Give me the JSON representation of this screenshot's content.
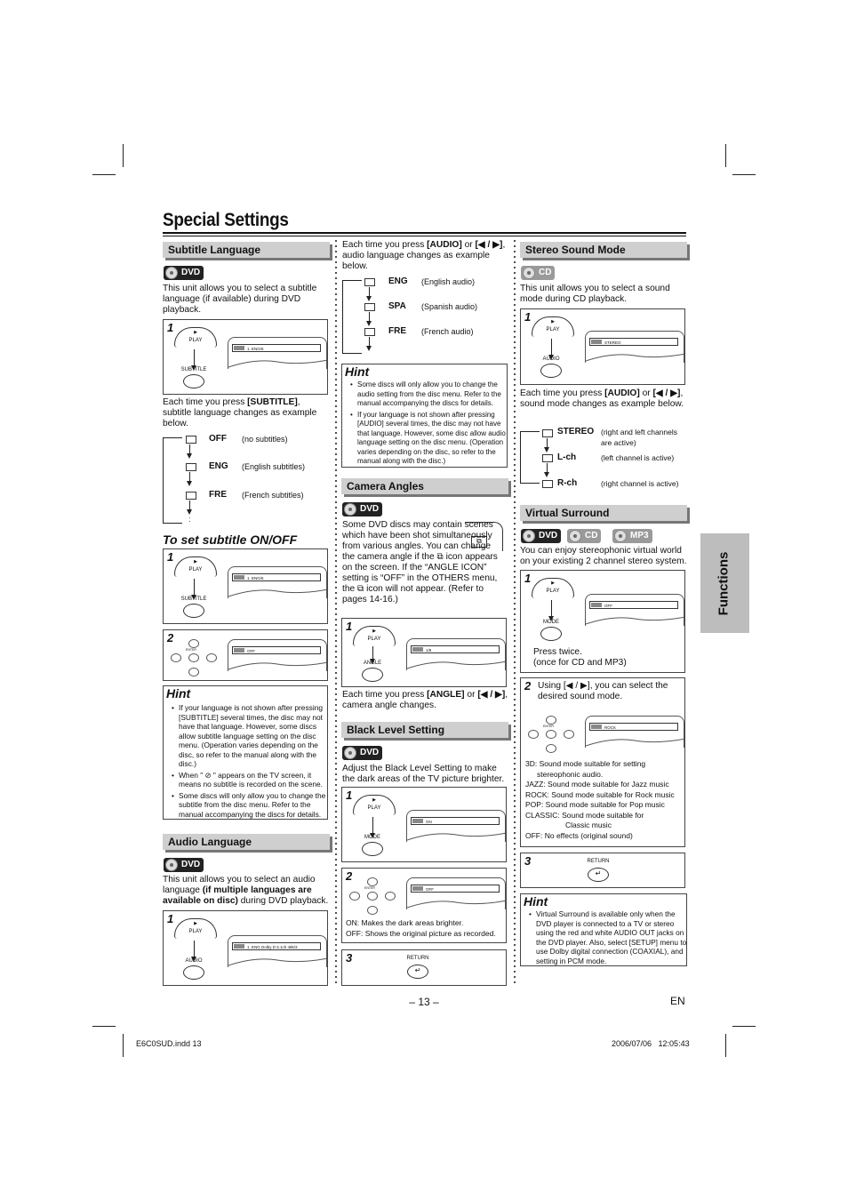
{
  "page": {
    "title": "Special Settings",
    "page_number": "– 13 –",
    "language": "EN",
    "side_tab": "Functions",
    "footer_left": "E6C0SUD.indd   13",
    "footer_right": "2006/07/06   12:05:43"
  },
  "subtitle_language": {
    "heading": "Subtitle Language",
    "badge": "DVD",
    "intro": "This unit allows you to select a subtitle language (if available) during DVD playback.",
    "step1": {
      "num": "1",
      "btn1": "PLAY",
      "btn2": "SUBTITLE",
      "screen": "1. ENG/6"
    },
    "each_time_pre": "Each time you press ",
    "each_time_key": "[SUBTITLE]",
    "each_time_post": ", subtitle language changes as example below.",
    "sequence": [
      {
        "code": "OFF",
        "desc": "(no subtitles)"
      },
      {
        "code": "ENG",
        "desc": "(English subtitles)"
      },
      {
        "code": "FRE",
        "desc": "(French subtitles)"
      }
    ],
    "onoff_heading": "To set subtitle ON/OFF",
    "onoff_step1": {
      "num": "1",
      "btn1": "PLAY",
      "btn2": "SUBTITLE",
      "screen": "1. ENG/6"
    },
    "onoff_step2": {
      "num": "2",
      "enter": "ENTER",
      "screen": "OFF"
    },
    "hint_title": "Hint",
    "hints": [
      "If your language is not shown after pressing [SUBTITLE] several times, the disc may not have that language. However, some discs allow subtitle language setting on the disc menu. (Operation varies depending on the disc, so refer to the manual along with the disc.)",
      "When \" ⊘ \" appears on the TV screen, it means no subtitle is recorded on the scene.",
      "Some discs will only allow you to change the subtitle from the disc menu. Refer to the manual accompanying the discs for details."
    ]
  },
  "audio_language": {
    "heading": "Audio Language",
    "badge": "DVD",
    "intro_pre": "This unit allows you to select an audio language ",
    "intro_bold": "(if multiple languages are available on disc)",
    "intro_post": " during DVD playback.",
    "step1": {
      "num": "1",
      "btn1": "PLAY",
      "btn2": "AUDIO",
      "screen": "1. ENG Dolby D 5.1ch 48k/3"
    },
    "each_time_pre": "Each time you press ",
    "each_time_key": "[AUDIO]",
    "each_time_mid": " or ",
    "each_time_key2": "[◀ / ▶]",
    "each_time_post": ", audio language changes as example below.",
    "sequence": [
      {
        "code": "ENG",
        "desc": "(English audio)"
      },
      {
        "code": "SPA",
        "desc": "(Spanish audio)"
      },
      {
        "code": "FRE",
        "desc": "(French audio)"
      }
    ],
    "hint_title": "Hint",
    "hints": [
      "Some discs will only allow you to change the audio setting from the disc menu. Refer to the manual accompanying the discs for details.",
      "If your language is not shown after pressing [AUDIO] several times, the disc may not have that language. However, some disc allow audio language setting on the disc menu. (Operation varies depending on the disc, so refer to the manual along with the disc.)"
    ]
  },
  "camera_angles": {
    "heading": "Camera Angles",
    "badge": "DVD",
    "intro": "Some DVD discs may contain scenes which have been shot simultaneously from various angles. You can change the camera angle if the ⧉ icon appears on the screen. If the “ANGLE ICON” setting is “OFF” in the OTHERS menu, the ⧉ icon will not appear. (Refer to pages 14-16.)",
    "step1": {
      "num": "1",
      "btn1": "PLAY",
      "btn2": "ANGLE",
      "screen": "1/8"
    },
    "each_time_pre": "Each time you press ",
    "each_time_key": "[ANGLE]",
    "each_time_mid": " or ",
    "each_time_key2": "[◀ / ▶]",
    "each_time_post": ", camera angle changes."
  },
  "black_level": {
    "heading": "Black Level Setting",
    "badge": "DVD",
    "intro": "Adjust the Black Level Setting to make the dark areas of the TV picture brighter.",
    "step1": {
      "num": "1",
      "btn1": "PLAY",
      "btn2": "MODE",
      "screen": "ON"
    },
    "step2": {
      "num": "2",
      "enter": "ENTER",
      "screen": "OFF",
      "note_on": "ON: Makes the dark areas brighter.",
      "note_off": "OFF: Shows the original picture as recorded."
    },
    "step3": {
      "num": "3",
      "btn": "RETURN"
    }
  },
  "stereo_sound": {
    "heading": "Stereo Sound Mode",
    "badge": "CD",
    "intro": "This unit allows you to select a sound mode during CD playback.",
    "step1": {
      "num": "1",
      "btn1": "PLAY",
      "btn2": "AUDIO",
      "screen": "STEREO"
    },
    "each_time_pre": "Each time you press ",
    "each_time_key": "[AUDIO]",
    "each_time_mid": " or ",
    "each_time_key2": "[◀ / ▶]",
    "each_time_post": ", sound mode changes as example below.",
    "sequence": [
      {
        "code": "STEREO",
        "desc": "(right and left channels are active)"
      },
      {
        "code": "L-ch",
        "desc": "(left channel is active)"
      },
      {
        "code": "R-ch",
        "desc": "(right channel is active)"
      }
    ]
  },
  "virtual_surround": {
    "heading": "Virtual Surround",
    "badges": [
      "DVD",
      "CD",
      "MP3"
    ],
    "intro": "You can enjoy stereophonic virtual world on your existing 2 channel stereo system.",
    "step1": {
      "num": "1",
      "btn1": "PLAY",
      "btn2": "MODE",
      "screen": "OFF",
      "note1": "Press twice.",
      "note2": "(once for CD and MP3)"
    },
    "step2": {
      "num": "2",
      "text": "Using [◀ / ▶], you can select the desired sound mode.",
      "enter": "ENTER",
      "screen": "ROCK",
      "modes": [
        "3D: Sound mode suitable for setting",
        "stereophonic audio.",
        "JAZZ: Sound mode suitable for Jazz music",
        "ROCK: Sound mode suitable for Rock music",
        "POP: Sound mode suitable for Pop music",
        "CLASSIC: Sound mode suitable for",
        "Classic music",
        "OFF: No effects (original sound)"
      ]
    },
    "step3": {
      "num": "3",
      "btn": "RETURN"
    },
    "hint_title": "Hint",
    "hints": [
      "Virtual Surround is available only when the DVD player is connected to a TV or stereo using the red and white AUDIO OUT jacks on the DVD player. Also, select [SETUP] menu to use Dolby digital connection (COAXIAL), and setting in PCM mode."
    ]
  }
}
